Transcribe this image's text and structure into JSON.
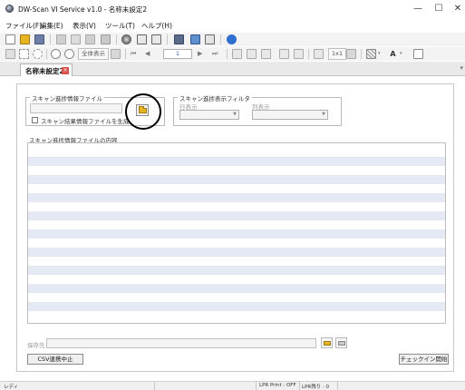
{
  "window": {
    "title": "DW-Scan VI Service v1.0 - 名称未設定2",
    "minimize": "—",
    "maximize": "☐",
    "close": "✕"
  },
  "menu": [
    "ファイル(F)",
    "編集(E)",
    "表示(V)",
    "ツール(T)",
    "ヘルプ(H)"
  ],
  "toolbar": {
    "fit_all_label": "全体表示",
    "page_value": "1",
    "zoom_label": "1x1",
    "text_label": "A"
  },
  "tab": {
    "label": "名称未設定2",
    "close": "×"
  },
  "scan_file_group": {
    "label": "スキャン進捗情報ファイル",
    "path_value": "",
    "generate_checkbox_label": "スキャン結果情報ファイルを生成"
  },
  "filter_group": {
    "label": "スキャン進捗表示フィルタ",
    "row_label": "行表示",
    "col_label": "列表示"
  },
  "content_group": {
    "label": "スキャン進捗情報ファイルの内容"
  },
  "save": {
    "label": "保存先",
    "value": ""
  },
  "buttons": {
    "csv_stop": "CSV連携中止",
    "checkin_start": "チェックイン開始"
  },
  "status": {
    "ready": "レディ",
    "lpr_print": "LPR Print : OFF",
    "lpr_remaining": "LPR残り : 0"
  },
  "colors": {
    "stripe": "#e4e9f3",
    "accent": "#3a60b5"
  }
}
